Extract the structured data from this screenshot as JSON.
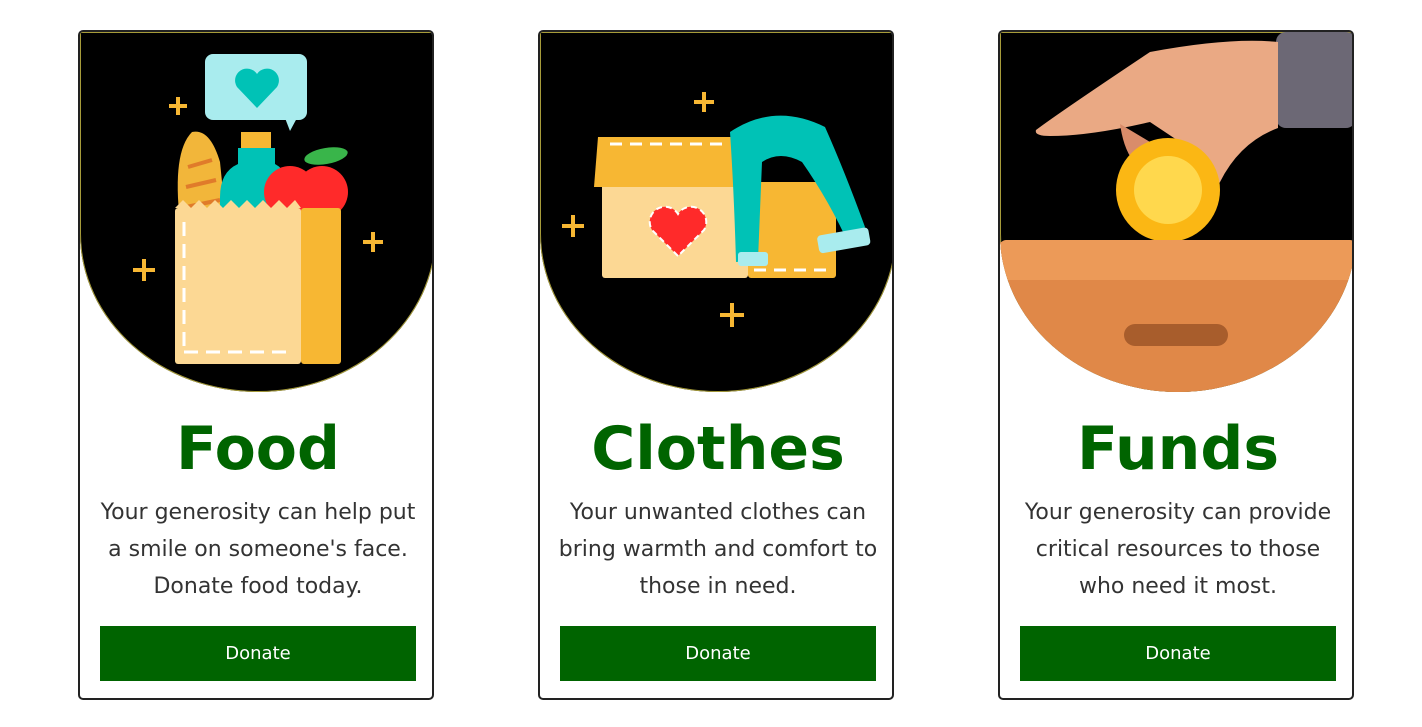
{
  "cards": [
    {
      "title": "Food",
      "description": "Your generosity can help put a smile on someone's face. Donate food today.",
      "button_label": "Donate",
      "illustration": "grocery-bag-icon"
    },
    {
      "title": "Clothes",
      "description": "Your unwanted clothes can bring warmth and comfort to those in need.",
      "button_label": "Donate",
      "illustration": "clothes-box-icon"
    },
    {
      "title": "Funds",
      "description": "Your generosity can provide critical resources to those who need it most.",
      "button_label": "Donate",
      "illustration": "coin-donation-icon"
    }
  ],
  "colors": {
    "title": "#006400",
    "button_bg": "#006400",
    "button_text": "#ffffff",
    "art_bg": "#000000",
    "text": "#333333"
  }
}
